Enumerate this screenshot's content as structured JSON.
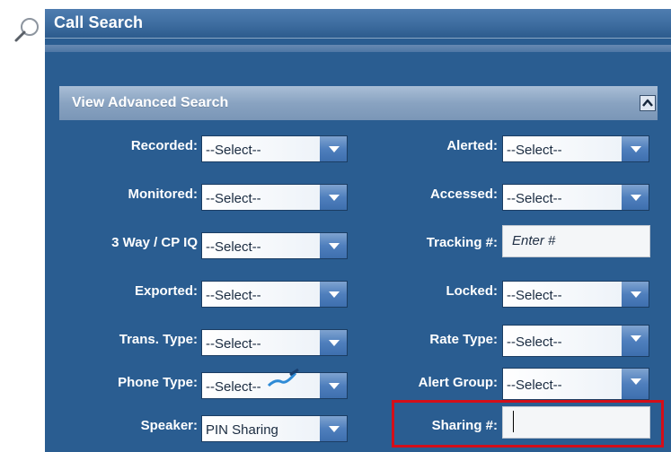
{
  "header": {
    "title": "Call Search"
  },
  "section": {
    "title": "View Advanced Search"
  },
  "left_fields": [
    {
      "label": "Recorded:",
      "value": "--Select--"
    },
    {
      "label": "Monitored:",
      "value": "--Select--"
    },
    {
      "label": "3 Way / CP IQ",
      "value": "--Select--"
    },
    {
      "label": "Exported:",
      "value": "--Select--"
    },
    {
      "label": "Trans. Type:",
      "value": "--Select--"
    },
    {
      "label": "Phone Type:",
      "value": "--Select--"
    },
    {
      "label": "Speaker:",
      "value": "PIN Sharing"
    }
  ],
  "right_fields": [
    {
      "label": "Alerted:",
      "value": "--Select--"
    },
    {
      "label": "Accessed:",
      "value": "--Select--"
    },
    {
      "label": "Tracking #:",
      "placeholder": "Enter #"
    },
    {
      "label": "Locked:",
      "value": "--Select--"
    },
    {
      "label": "Rate Type:",
      "value": "--Select--"
    },
    {
      "label": "Alert Group:",
      "value": "--Select--"
    },
    {
      "label": "Sharing #:",
      "value": ""
    }
  ],
  "colors": {
    "panel": "#2a5d91",
    "highlight_border": "#d40e19"
  },
  "icons": {
    "header": "magnifier-icon",
    "collapse": "chevron-up-icon",
    "dropdown": "chevron-down-icon",
    "phone_type_overlay": "pen-icon"
  }
}
